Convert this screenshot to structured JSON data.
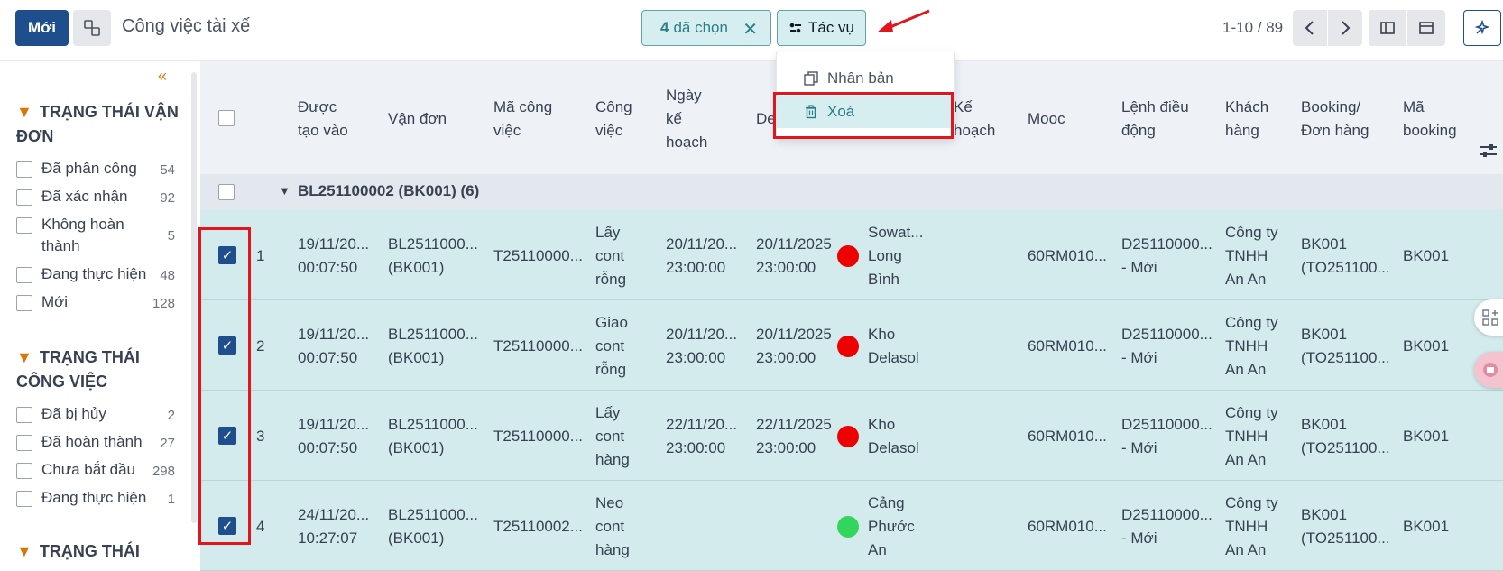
{
  "toolbar": {
    "new_label": "Mới",
    "title": "Công việc tài xế",
    "selected_count": "4",
    "selected_label": "đã chọn",
    "actions_label": "Tác vụ",
    "pager": "1-10 / 89"
  },
  "actions_menu": [
    {
      "label": "Nhân bản",
      "icon": "duplicate-icon"
    },
    {
      "label": "Xoá",
      "icon": "trash-icon"
    }
  ],
  "sidebar": {
    "groups": [
      {
        "title": "TRẠNG THÁI VẬN ĐƠN",
        "items": [
          {
            "label": "Đã phân công",
            "count": "54"
          },
          {
            "label": "Đã xác nhận",
            "count": "92"
          },
          {
            "label": "Không hoàn thành",
            "count": "5"
          },
          {
            "label": "Đang thực hiện",
            "count": "48"
          },
          {
            "label": "Mới",
            "count": "128"
          }
        ]
      },
      {
        "title": "TRẠNG THÁI CÔNG VIỆC",
        "items": [
          {
            "label": "Đã bị hủy",
            "count": "2"
          },
          {
            "label": "Đã hoàn thành",
            "count": "27"
          },
          {
            "label": "Chưa bắt đầu",
            "count": "298"
          },
          {
            "label": "Đang thực hiện",
            "count": "1"
          }
        ]
      },
      {
        "title": "TRẠNG THÁI",
        "items": []
      }
    ]
  },
  "table": {
    "columns": [
      "Được tạo vào",
      "Vận đơn",
      "Mã công việc",
      "Công việc",
      "Ngày kế hoạch",
      "De",
      "Kế hoạch",
      "Mooc",
      "Lệnh điều động",
      "Khách hàng",
      "Booking/ Đơn hàng",
      "Mã booking"
    ],
    "group_label": "BL251100002 (BK001) (6)",
    "rows": [
      {
        "no": "1",
        "created_1": "19/11/20...",
        "created_2": "00:07:50",
        "bl_1": "BL2511000...",
        "bl_2": "(BK001)",
        "task_code": "T25110000...",
        "task_1": "Lấy",
        "task_2": "cont",
        "task_3": "rỗng",
        "plan_1": "20/11/20...",
        "plan_2": "23:00:00",
        "de_1": "20/11/2025",
        "de_2": "23:00:00",
        "status_color": "#ee0000",
        "loc_1": "Sowat...",
        "loc_2": "Long",
        "loc_3": "Bình",
        "mooc": "60RM010...",
        "order_1": "D25110000...",
        "order_2": "- Mới",
        "cust_1": "Công ty",
        "cust_2": "TNHH",
        "cust_3": "An An",
        "bk_1": "BK001",
        "bk_2": "(TO251100...",
        "bk_code": "BK001"
      },
      {
        "no": "2",
        "created_1": "19/11/20...",
        "created_2": "00:07:50",
        "bl_1": "BL2511000...",
        "bl_2": "(BK001)",
        "task_code": "T25110000...",
        "task_1": "Giao",
        "task_2": "cont",
        "task_3": "rỗng",
        "plan_1": "20/11/20...",
        "plan_2": "23:00:00",
        "de_1": "20/11/2025",
        "de_2": "23:00:00",
        "status_color": "#ee0000",
        "loc_1": "Kho",
        "loc_2": "Delasol",
        "loc_3": "",
        "mooc": "60RM010...",
        "order_1": "D25110000...",
        "order_2": "- Mới",
        "cust_1": "Công ty",
        "cust_2": "TNHH",
        "cust_3": "An An",
        "bk_1": "BK001",
        "bk_2": "(TO251100...",
        "bk_code": "BK001"
      },
      {
        "no": "3",
        "created_1": "19/11/20...",
        "created_2": "00:07:50",
        "bl_1": "BL2511000...",
        "bl_2": "(BK001)",
        "task_code": "T25110000...",
        "task_1": "Lấy",
        "task_2": "cont",
        "task_3": "hàng",
        "plan_1": "22/11/20...",
        "plan_2": "23:00:00",
        "de_1": "22/11/2025",
        "de_2": "23:00:00",
        "status_color": "#ee0000",
        "loc_1": "Kho",
        "loc_2": "Delasol",
        "loc_3": "",
        "mooc": "60RM010...",
        "order_1": "D25110000...",
        "order_2": "- Mới",
        "cust_1": "Công ty",
        "cust_2": "TNHH",
        "cust_3": "An An",
        "bk_1": "BK001",
        "bk_2": "(TO251100...",
        "bk_code": "BK001"
      },
      {
        "no": "4",
        "created_1": "24/11/20...",
        "created_2": "10:27:07",
        "bl_1": "BL2511000...",
        "bl_2": "(BK001)",
        "task_code": "T25110002...",
        "task_1": "Neo",
        "task_2": "cont",
        "task_3": "hàng",
        "plan_1": "",
        "plan_2": "",
        "de_1": "",
        "de_2": "",
        "status_color": "#33d65c",
        "loc_1": "Cảng",
        "loc_2": "Phước",
        "loc_3": "An",
        "mooc": "60RM010...",
        "order_1": "D25110000...",
        "order_2": "- Mới",
        "cust_1": "Công ty",
        "cust_2": "TNHH",
        "cust_3": "An An",
        "bk_1": "BK001",
        "bk_2": "(TO251100...",
        "bk_code": "BK001"
      }
    ]
  },
  "colors": {
    "primary": "#1f4e8c",
    "accent": "#2a7e87",
    "row_selected": "#d3ebed",
    "annotation": "#e3141b"
  }
}
